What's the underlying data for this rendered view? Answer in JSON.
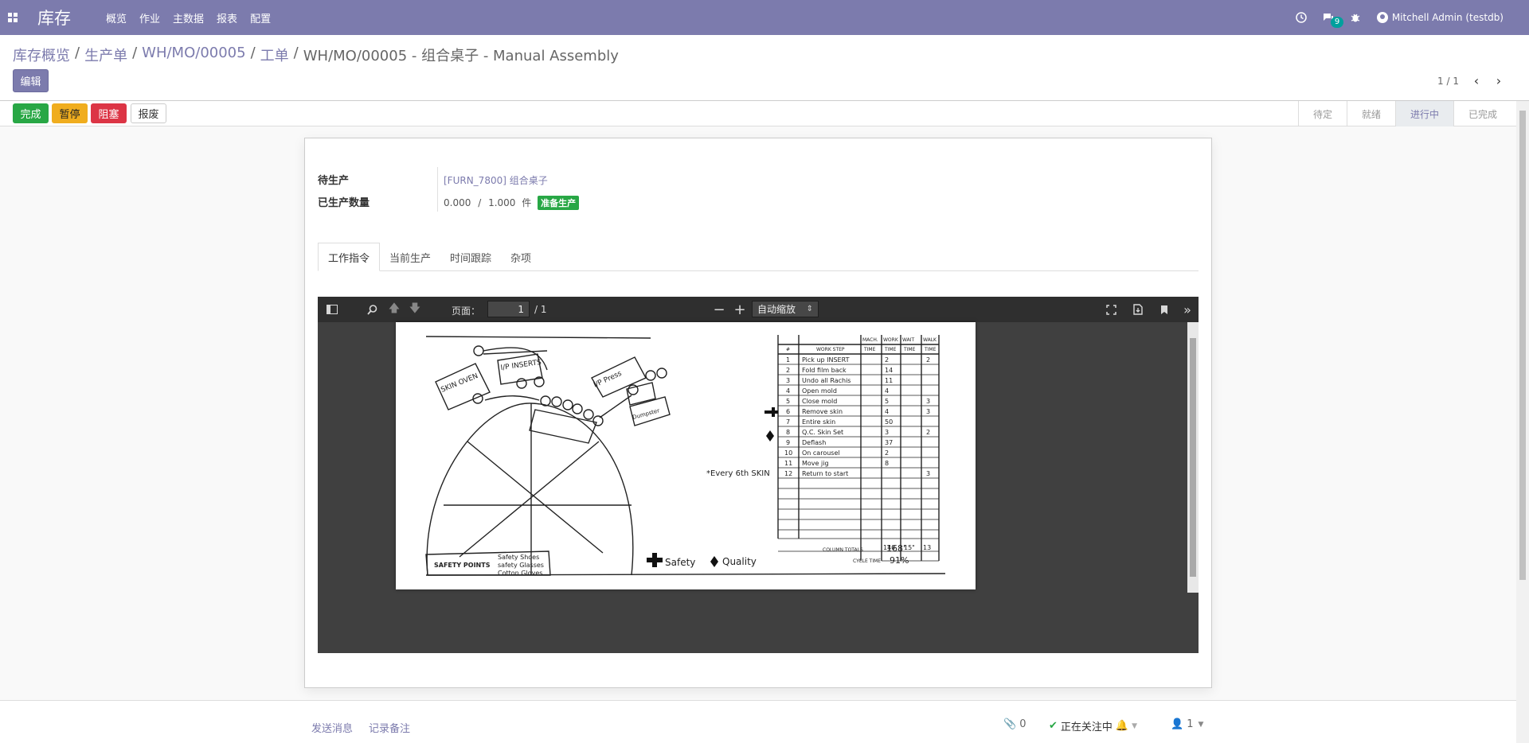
{
  "navbar": {
    "brand": "库存",
    "menu": [
      "概览",
      "作业",
      "主数据",
      "报表",
      "配置"
    ],
    "messages_count": "9",
    "user": "Mitchell Admin (testdb)"
  },
  "breadcrumb": {
    "items": [
      "库存概览",
      "生产单",
      "WH/MO/00005",
      "工单"
    ],
    "separator": "/",
    "current": "WH/MO/00005 - 组合桌子 - Manual Assembly"
  },
  "control": {
    "edit_label": "编辑",
    "pager": "1 / 1"
  },
  "actions": {
    "done": "完成",
    "pause": "暂停",
    "block": "阻塞",
    "scrap": "报废"
  },
  "stages": [
    "待定",
    "就绪",
    "进行中",
    "已完成"
  ],
  "form": {
    "to_produce_label": "待生产",
    "to_produce_value": "[FURN_7800] 组合桌子",
    "produced_qty_label": "已生产数量",
    "produced_qty_value": "0.000",
    "qty_separator": "/",
    "qty_total": "1.000",
    "uom": "件",
    "status_tag": "准备生产"
  },
  "tabs": [
    "工作指令",
    "当前生产",
    "时间跟踪",
    "杂项"
  ],
  "pdf": {
    "page_label": "页面：",
    "page_value": "1",
    "page_total": "/ 1",
    "zoom": "自动缩放"
  },
  "chatter": {
    "send_message": "发送消息",
    "log_note": "记录备注",
    "attachments": "0",
    "following": "正在关注中",
    "followers": "1"
  },
  "colors": {
    "brand": "#7c7bad",
    "success": "#28a745",
    "warning": "#f0ad1e",
    "danger": "#dc3545"
  }
}
